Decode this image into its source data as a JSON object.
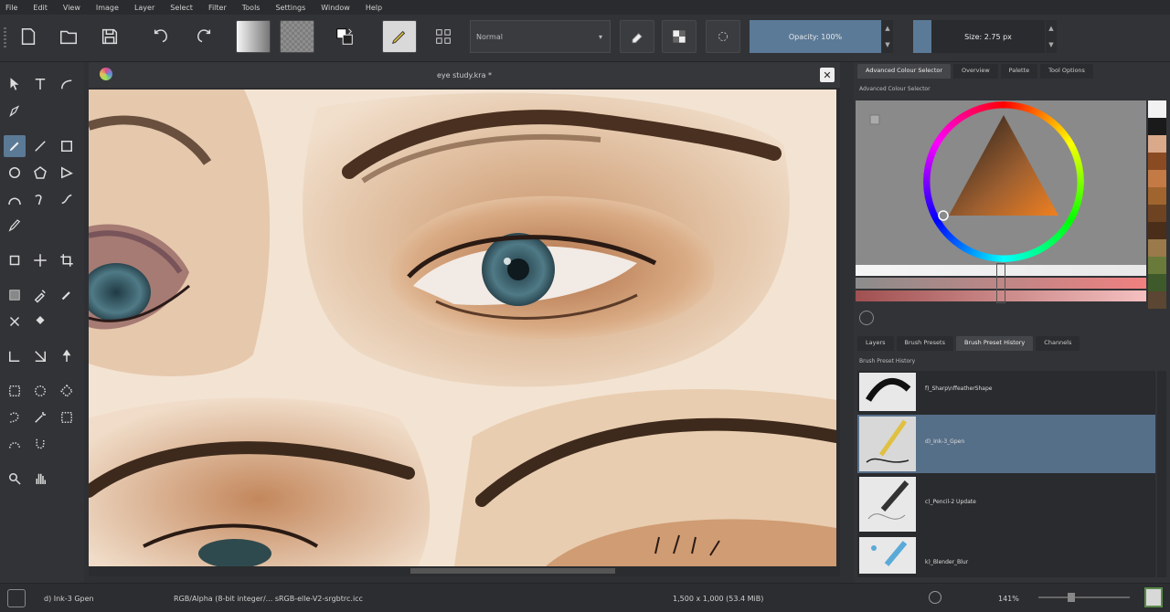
{
  "menu": [
    "File",
    "Edit",
    "View",
    "Image",
    "Layer",
    "Select",
    "Filter",
    "Tools",
    "Settings",
    "Window",
    "Help"
  ],
  "toolbar": {
    "blend_mode": "Normal",
    "opacity_label": "Opacity: 100%",
    "size_label": "Size: 2.75 px"
  },
  "document": {
    "tab_title": "eye study.kra *",
    "close_glyph": "✕"
  },
  "dock": {
    "top_tabs": [
      "Advanced Colour Selector",
      "Overview",
      "Palette",
      "Tool Options"
    ],
    "selector_title": "Advanced Colour Selector",
    "bottom_tabs": [
      "Layers",
      "Brush Presets",
      "Brush Preset History",
      "Channels"
    ],
    "history_title": "Brush Preset History",
    "brushes": [
      {
        "label": "f)_Sharp\\nffeatherShape"
      },
      {
        "label": "d)_Ink-3_Gpen"
      },
      {
        "label": "c)_Pencil-2 Update"
      },
      {
        "label": "k)_Blender_Blur"
      }
    ],
    "swatch_colors": [
      "#f2f2f2",
      "#1a1a1a",
      "#d9a98a",
      "#8a4a22",
      "#c47a44",
      "#a0642e",
      "#6e4322",
      "#4a2e1a",
      "#9a7a4a",
      "#6a7a3a",
      "#3e5a2a",
      "#5a4632"
    ]
  },
  "status": {
    "brush": "d) Ink-3 Gpen",
    "color_space": "RGB/Alpha (8-bit integer/... sRGB-elle-V2-srgbtrc.icc",
    "dimensions": "1,500 x 1,000 (53.4 MiB)",
    "zoom": "141%"
  },
  "colors": {
    "accent": "#5b7a97",
    "active_row": "#566f88"
  }
}
